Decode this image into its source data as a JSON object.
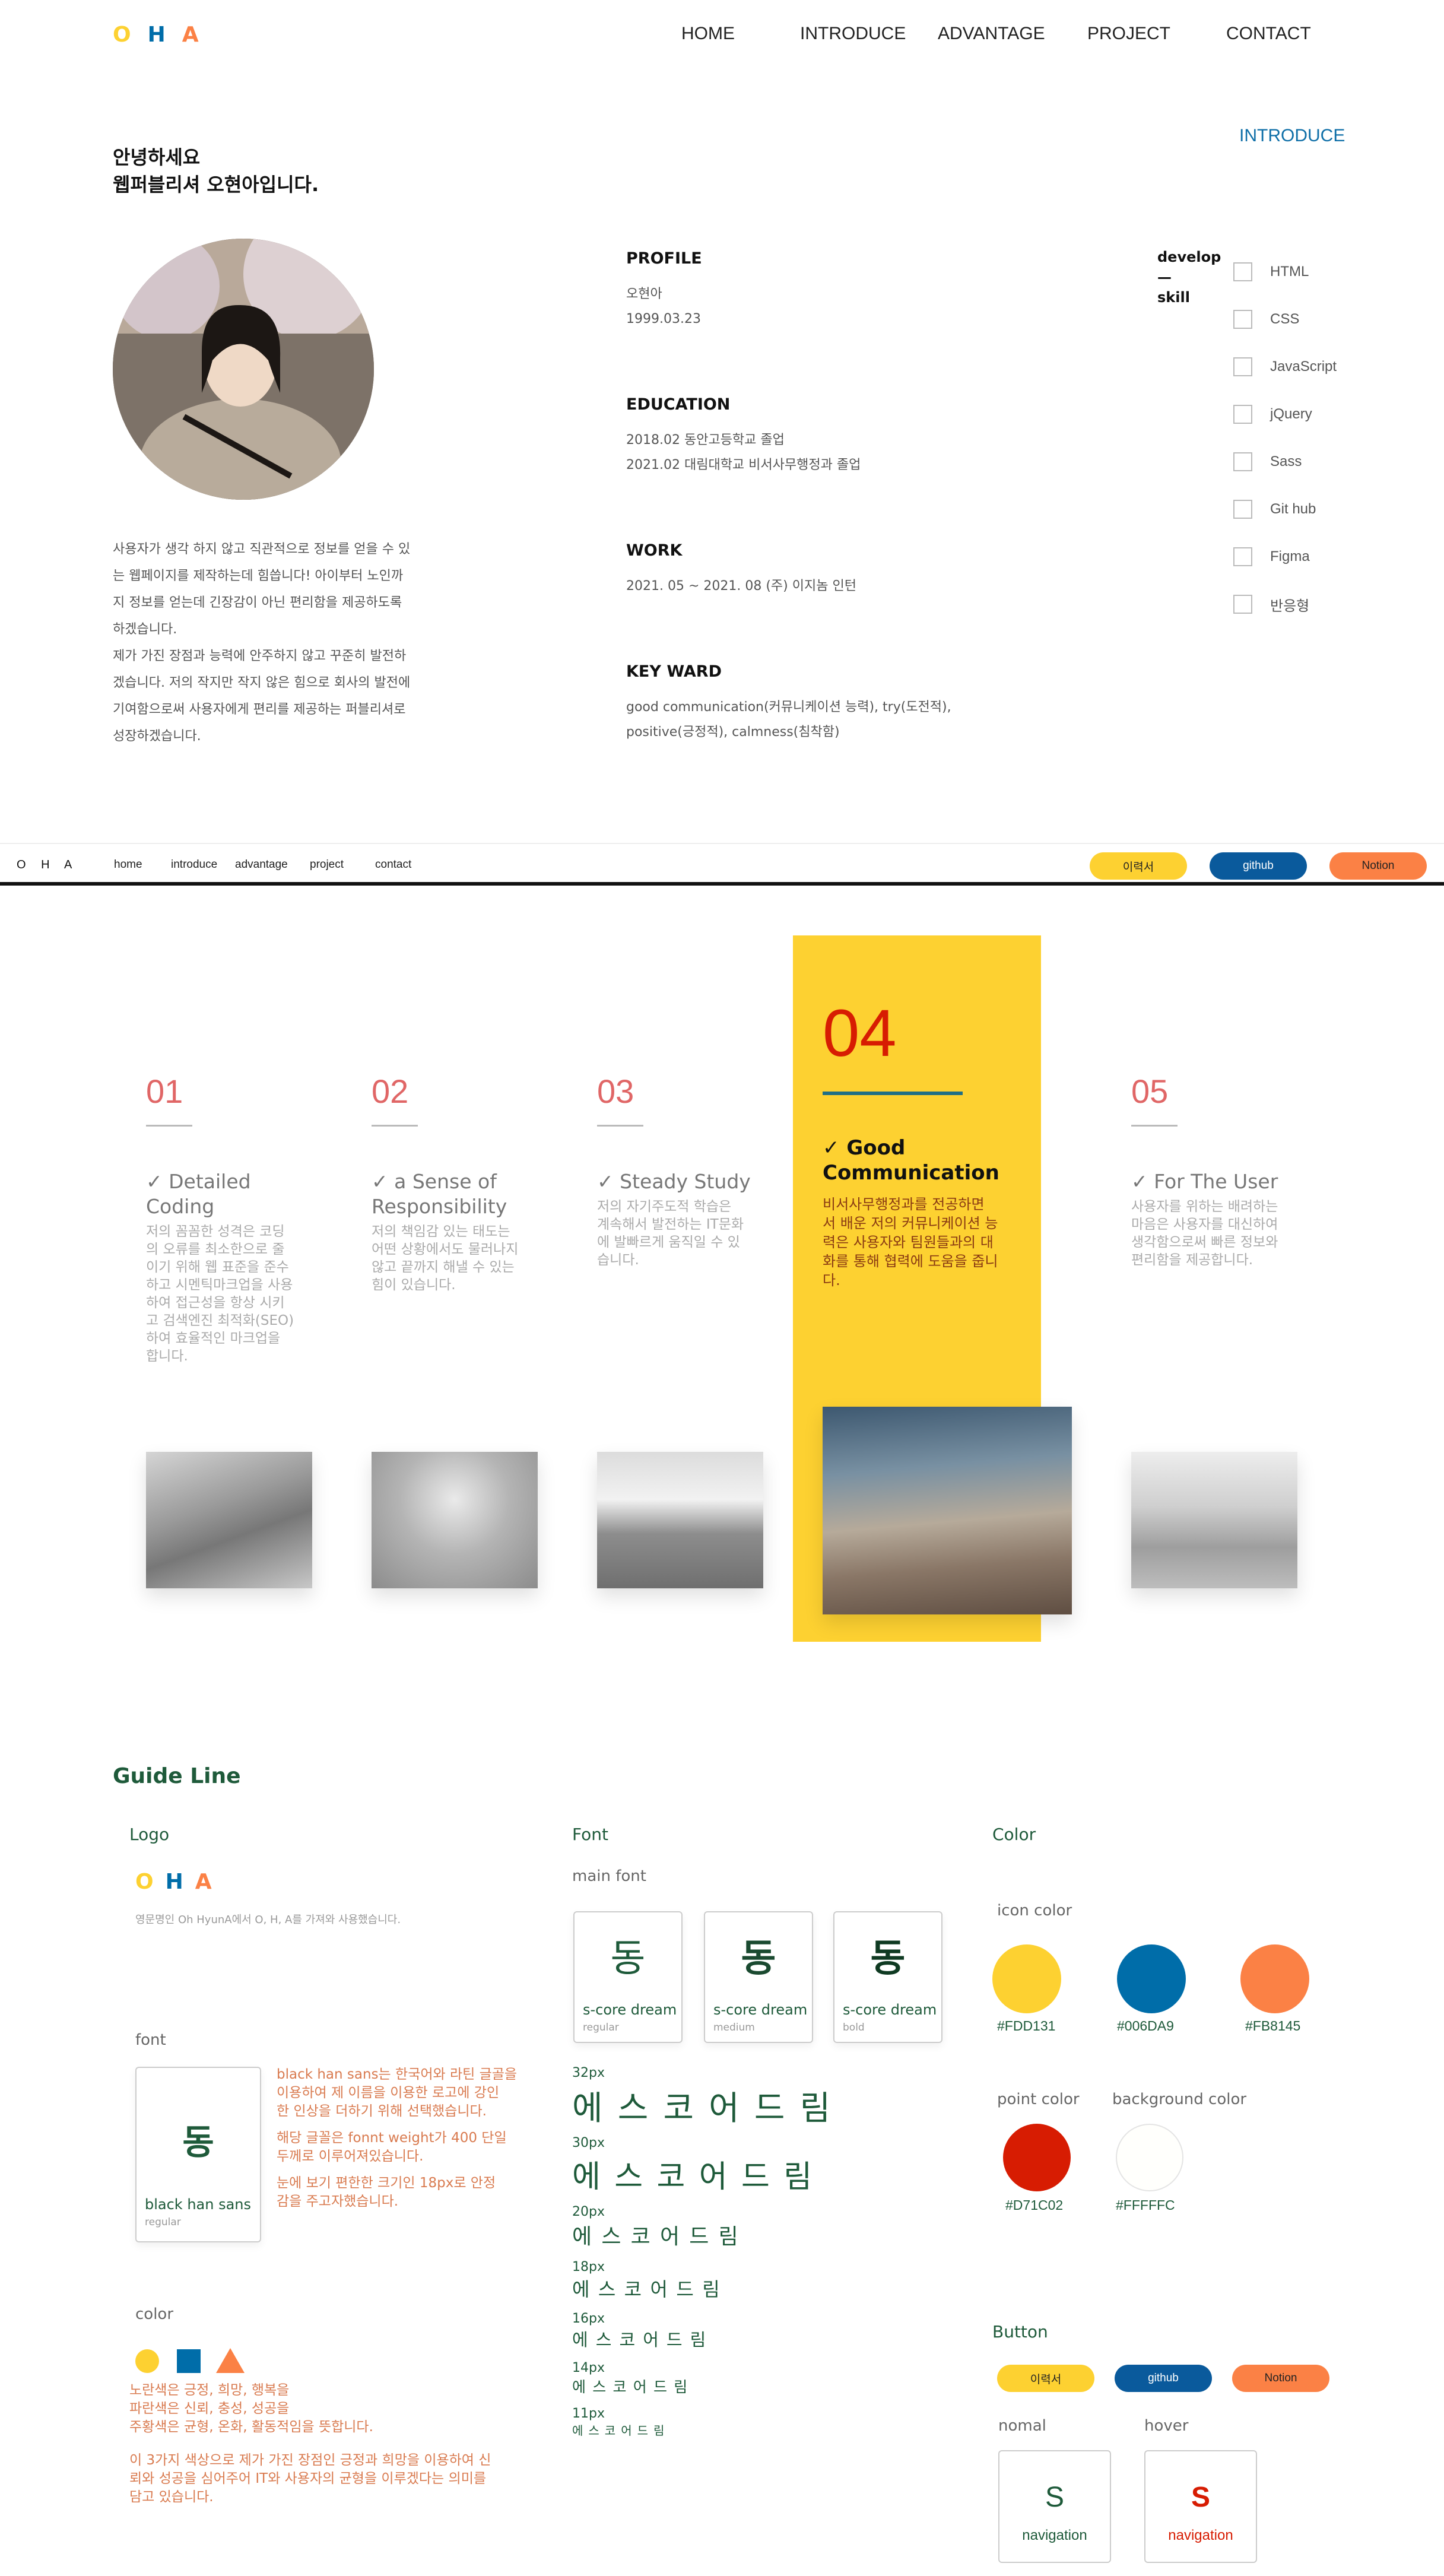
{
  "nav": {
    "logo": [
      "O",
      "H",
      "A"
    ],
    "links": [
      "HOME",
      "INTRODUCE",
      "ADVANTAGE",
      "PROJECT",
      "CONTACT"
    ]
  },
  "intro": {
    "section_tag": "INTRODUCE",
    "greeting_line1": "안녕하세요",
    "greeting_line2": "웹퍼블리셔 오현아입니다.",
    "bio": [
      "사용자가 생각 하지 않고 직관적으로 정보를 얻을 수 있",
      "는 웹페이지를 제작하는데 힘씁니다! 아이부터 노인까",
      "지 정보를 얻는데 긴장감이 아닌 편리함을 제공하도록",
      "하겠습니다.",
      "제가 가진 장점과 능력에 안주하지 않고 꾸준히 발전하",
      "겠습니다. 저의 작지만 작지 않은 힘으로 회사의 발전에",
      "기여함으로써 사용자에게 편리를 제공하는 퍼블리셔로",
      "성장하겠습니다."
    ],
    "profile": {
      "title": "PROFILE",
      "lines": [
        "오현아",
        "1999.03.23"
      ]
    },
    "education": {
      "title": "EDUCATION",
      "lines": [
        "2018.02 동안고등학교 졸업",
        "2021.02 대림대학교 비서사무행정과 졸업"
      ]
    },
    "work": {
      "title": "WORK",
      "lines": [
        "2021. 05 ~ 2021. 08 (주) 이지놈 인턴"
      ]
    },
    "keyword": {
      "title": "KEY WARD",
      "lines": [
        "good communication(커뮤니케이션 능력), try(도전적),",
        "positive(긍정적), calmness(침착함)"
      ]
    },
    "skills": {
      "title_top": "develop",
      "title_dash": "—",
      "title_bottom": "skill",
      "items": [
        "HTML",
        "CSS",
        "JavaScript",
        "jQuery",
        "Sass",
        "Git hub",
        "Figma",
        "반응형"
      ]
    }
  },
  "sticky_bar": {
    "logo": "O H A",
    "links": [
      "home",
      "introduce",
      "advantage",
      "project",
      "contact"
    ],
    "buttons": [
      {
        "label": "이력서",
        "color": "#FDD131",
        "text_color": "#222222"
      },
      {
        "label": "github",
        "color": "#006DA9",
        "text_color": "#ffffff"
      },
      {
        "label": "Notion",
        "color": "#FB8145",
        "text_color": "#222222"
      }
    ]
  },
  "strengths": [
    {
      "num": "01",
      "title_l1": "✓ Detailed",
      "title_l2": "Coding",
      "body": [
        "저의 꼼꼼한 성격은 코딩",
        "의 오류를 최소한으로 줄",
        "이기 위해 웹 표준을 준수",
        "하고 시멘틱마크업을 사용",
        "하여 접근성을 항상 시키",
        "고 검색엔진 최적화(SEO)",
        "하여 효율적인 마크업을",
        "합니다."
      ]
    },
    {
      "num": "02",
      "title_l1": "✓ a Sense of",
      "title_l2": "Responsibility",
      "body": [
        "저의 책임감 있는 태도는",
        "어떤 상황에서도 물러나지",
        "않고 끝까지 해낼 수 있는",
        "힘이 있습니다."
      ]
    },
    {
      "num": "03",
      "title_l1": "✓ Steady Study",
      "title_l2": "",
      "body": [
        "저의 자기주도적 학습은",
        "계속해서 발전하는 IT문화",
        "에 발빠르게 움직일 수 있",
        "습니다."
      ]
    },
    {
      "num": "04",
      "title_l1": "✓ Good",
      "title_l2": "Communication",
      "body": [
        "비서사무행정과를 전공하면",
        "서 배운 저의 커뮤니케이션 능",
        "력은 사용자와 팀원들과의 대",
        "화를 통해 협력에 도움을 줍니",
        "다."
      ]
    },
    {
      "num": "05",
      "title_l1": "✓ For The User",
      "title_l2": "",
      "body": [
        "사용자를 위하는 배려하는",
        "마음은 사용자를 대신하여",
        "생각함으로써 빠른 정보와",
        "편리함을 제공합니다."
      ]
    }
  ],
  "guide": {
    "title": "Guide Line",
    "logo": {
      "heading": "Logo",
      "letters": [
        "O",
        "H",
        "A"
      ],
      "caption": "영문명인 Oh HyunA에서 O, H, A를 가져와 사용했습니다."
    },
    "logo_font": {
      "heading": "font",
      "glyph": "동",
      "name": "black han sans",
      "weight": "regular",
      "desc": [
        [
          "black han sans는 한국어와 라틴 글골을",
          "이용하여 제 이름을 이용한 로고에 강인",
          "한 인상을 더하기 위해 선택했습니다."
        ],
        [
          "해당 글꼴은 fonnt weight가 400 단일",
          "두께로 이루어져있습니다."
        ],
        [
          "눈에 보기 편한한 크기인 18px로 안정",
          "감을 주고자했습니다."
        ]
      ]
    },
    "logo_color": {
      "heading": "color",
      "meaning": [
        "노란색은 긍정, 희망, 행복을",
        "파란색은 신뢰, 충성, 성공을",
        "주황색은 균형, 온화, 활동적임을 뜻합니다."
      ],
      "summary": [
        "이 3가지 색상으로 제가 가진 장점인 긍정과 희망을 이용하여 신",
        "뢰와 성공을 심어주어 IT와 사용자의 균형을 이루겠다는 의미를",
        "담고 있습니다."
      ]
    },
    "font": {
      "heading": "Font",
      "main_label": "main font",
      "cards": [
        {
          "glyph": "동",
          "name": "s-core dream",
          "weight": "regular"
        },
        {
          "glyph": "동",
          "name": "s-core dream",
          "weight": "medium"
        },
        {
          "glyph": "동",
          "name": "s-core dream",
          "weight": "bold"
        }
      ],
      "samples": [
        {
          "label": "32px",
          "text": "에스코어드림"
        },
        {
          "label": "30px",
          "text": "에스코어드림"
        },
        {
          "label": "20px",
          "text": "에스코어드림"
        },
        {
          "label": "18px",
          "text": "에스코어드림"
        },
        {
          "label": "16px",
          "text": "에스코어드림"
        },
        {
          "label": "14px",
          "text": "에스코어드림"
        },
        {
          "label": "11px",
          "text": "에스코어드림"
        }
      ]
    },
    "color": {
      "heading": "Color",
      "icon_label": "icon color",
      "icon_colors": [
        "#FDD131",
        "#006DA9",
        "#FB8145"
      ],
      "point_label": "point color",
      "point_color": "#D71C02",
      "bg_label": "background color",
      "bg_color": "#FFFFFC"
    },
    "button": {
      "heading": "Button",
      "pills": [
        "이력서",
        "github",
        "Notion"
      ],
      "normal_label": "nomal",
      "hover_label": "hover",
      "card_letter": "S",
      "card_text": "navigation"
    }
  }
}
